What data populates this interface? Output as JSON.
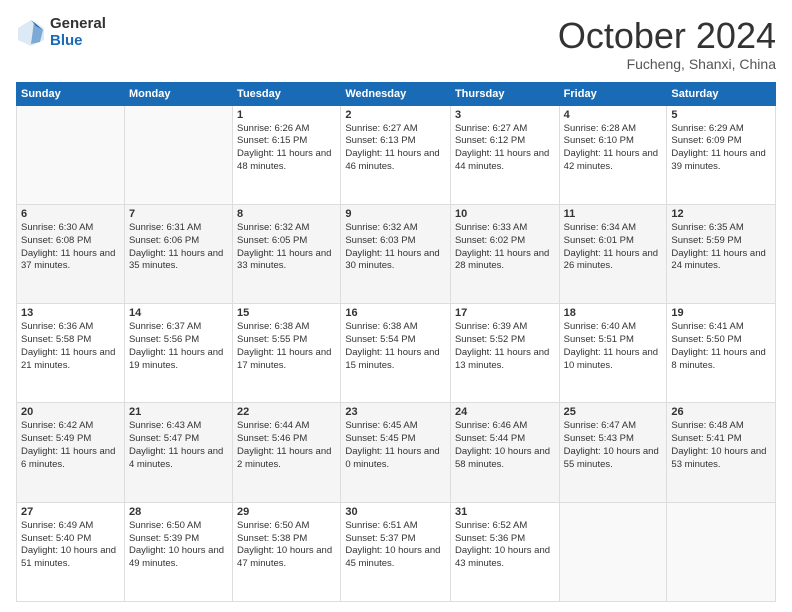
{
  "logo": {
    "general": "General",
    "blue": "Blue"
  },
  "title": "October 2024",
  "location": "Fucheng, Shanxi, China",
  "weekdays": [
    "Sunday",
    "Monday",
    "Tuesday",
    "Wednesday",
    "Thursday",
    "Friday",
    "Saturday"
  ],
  "weeks": [
    [
      {
        "day": "",
        "info": ""
      },
      {
        "day": "",
        "info": ""
      },
      {
        "day": "1",
        "info": "Sunrise: 6:26 AM\nSunset: 6:15 PM\nDaylight: 11 hours and 48 minutes."
      },
      {
        "day": "2",
        "info": "Sunrise: 6:27 AM\nSunset: 6:13 PM\nDaylight: 11 hours and 46 minutes."
      },
      {
        "day": "3",
        "info": "Sunrise: 6:27 AM\nSunset: 6:12 PM\nDaylight: 11 hours and 44 minutes."
      },
      {
        "day": "4",
        "info": "Sunrise: 6:28 AM\nSunset: 6:10 PM\nDaylight: 11 hours and 42 minutes."
      },
      {
        "day": "5",
        "info": "Sunrise: 6:29 AM\nSunset: 6:09 PM\nDaylight: 11 hours and 39 minutes."
      }
    ],
    [
      {
        "day": "6",
        "info": "Sunrise: 6:30 AM\nSunset: 6:08 PM\nDaylight: 11 hours and 37 minutes."
      },
      {
        "day": "7",
        "info": "Sunrise: 6:31 AM\nSunset: 6:06 PM\nDaylight: 11 hours and 35 minutes."
      },
      {
        "day": "8",
        "info": "Sunrise: 6:32 AM\nSunset: 6:05 PM\nDaylight: 11 hours and 33 minutes."
      },
      {
        "day": "9",
        "info": "Sunrise: 6:32 AM\nSunset: 6:03 PM\nDaylight: 11 hours and 30 minutes."
      },
      {
        "day": "10",
        "info": "Sunrise: 6:33 AM\nSunset: 6:02 PM\nDaylight: 11 hours and 28 minutes."
      },
      {
        "day": "11",
        "info": "Sunrise: 6:34 AM\nSunset: 6:01 PM\nDaylight: 11 hours and 26 minutes."
      },
      {
        "day": "12",
        "info": "Sunrise: 6:35 AM\nSunset: 5:59 PM\nDaylight: 11 hours and 24 minutes."
      }
    ],
    [
      {
        "day": "13",
        "info": "Sunrise: 6:36 AM\nSunset: 5:58 PM\nDaylight: 11 hours and 21 minutes."
      },
      {
        "day": "14",
        "info": "Sunrise: 6:37 AM\nSunset: 5:56 PM\nDaylight: 11 hours and 19 minutes."
      },
      {
        "day": "15",
        "info": "Sunrise: 6:38 AM\nSunset: 5:55 PM\nDaylight: 11 hours and 17 minutes."
      },
      {
        "day": "16",
        "info": "Sunrise: 6:38 AM\nSunset: 5:54 PM\nDaylight: 11 hours and 15 minutes."
      },
      {
        "day": "17",
        "info": "Sunrise: 6:39 AM\nSunset: 5:52 PM\nDaylight: 11 hours and 13 minutes."
      },
      {
        "day": "18",
        "info": "Sunrise: 6:40 AM\nSunset: 5:51 PM\nDaylight: 11 hours and 10 minutes."
      },
      {
        "day": "19",
        "info": "Sunrise: 6:41 AM\nSunset: 5:50 PM\nDaylight: 11 hours and 8 minutes."
      }
    ],
    [
      {
        "day": "20",
        "info": "Sunrise: 6:42 AM\nSunset: 5:49 PM\nDaylight: 11 hours and 6 minutes."
      },
      {
        "day": "21",
        "info": "Sunrise: 6:43 AM\nSunset: 5:47 PM\nDaylight: 11 hours and 4 minutes."
      },
      {
        "day": "22",
        "info": "Sunrise: 6:44 AM\nSunset: 5:46 PM\nDaylight: 11 hours and 2 minutes."
      },
      {
        "day": "23",
        "info": "Sunrise: 6:45 AM\nSunset: 5:45 PM\nDaylight: 11 hours and 0 minutes."
      },
      {
        "day": "24",
        "info": "Sunrise: 6:46 AM\nSunset: 5:44 PM\nDaylight: 10 hours and 58 minutes."
      },
      {
        "day": "25",
        "info": "Sunrise: 6:47 AM\nSunset: 5:43 PM\nDaylight: 10 hours and 55 minutes."
      },
      {
        "day": "26",
        "info": "Sunrise: 6:48 AM\nSunset: 5:41 PM\nDaylight: 10 hours and 53 minutes."
      }
    ],
    [
      {
        "day": "27",
        "info": "Sunrise: 6:49 AM\nSunset: 5:40 PM\nDaylight: 10 hours and 51 minutes."
      },
      {
        "day": "28",
        "info": "Sunrise: 6:50 AM\nSunset: 5:39 PM\nDaylight: 10 hours and 49 minutes."
      },
      {
        "day": "29",
        "info": "Sunrise: 6:50 AM\nSunset: 5:38 PM\nDaylight: 10 hours and 47 minutes."
      },
      {
        "day": "30",
        "info": "Sunrise: 6:51 AM\nSunset: 5:37 PM\nDaylight: 10 hours and 45 minutes."
      },
      {
        "day": "31",
        "info": "Sunrise: 6:52 AM\nSunset: 5:36 PM\nDaylight: 10 hours and 43 minutes."
      },
      {
        "day": "",
        "info": ""
      },
      {
        "day": "",
        "info": ""
      }
    ]
  ]
}
